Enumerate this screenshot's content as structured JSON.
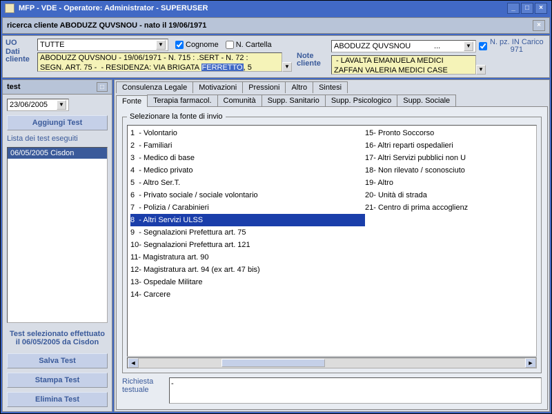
{
  "title": "MFP  - VDE  - Operatore: Administrator  - SUPERUSER",
  "client_bar": "ricerca cliente  ABODUZZ QUVSNOU - nato il 19/06/1971",
  "filters": {
    "uo_label": "UO",
    "uo_value": "TUTTE",
    "cognome": "Cognome",
    "ncartella": "N. Cartella",
    "client_name": "ABODUZZ QUVSNOU",
    "client_dots": "...",
    "dati_label": "Dati cliente",
    "dati_line1": "ABODUZZ QUVSNOU - 19/06/1971 - N. 715 : .SERT - N. 72 :",
    "dati_line2a": "SEGN. ART. 75 -  - RESIDENZA: VIA BRIGATA ",
    "dati_line2_hl": "FERRETTO",
    "dati_line2b": ", 5",
    "note_label": "Note cliente",
    "note_line1": " - LAVALTA EMANUELA MEDICI",
    "note_line2": "ZAFFAN VALERIA MEDICI CASE",
    "np_label": "N. pz. IN Carico",
    "np_value": "971"
  },
  "left": {
    "title": "test",
    "date": "23/06/2005",
    "add": "Aggiungi Test",
    "list_label": "Lista dei test eseguiti",
    "item": "06/05/2005   Cisdon",
    "status": "Test selezionato effettuato il 06/05/2005 da Cisdon",
    "save": "Salva Test",
    "print": "Stampa Test",
    "del": "Elimina Test"
  },
  "tabs_row1": [
    "Consulenza Legale",
    "Motivazioni",
    "Pressioni",
    "Altro",
    "Sintesi"
  ],
  "tabs_row2": [
    "Fonte",
    "Terapia farmacol.",
    "Comunità",
    "Supp. Sanitario",
    "Supp. Psicologico",
    "Supp. Sociale"
  ],
  "active_tab": "Fonte",
  "fieldset": "Selezionare la fonte di invio",
  "list_left": [
    "1  - Volontario",
    "2  - Familiari",
    "3  - Medico di base",
    "4  - Medico privato",
    "5  - Altro Ser.T.",
    "6  - Privato sociale / sociale volontario",
    "7  - Polizia / Carabinieri",
    "8  - Altri Servizi ULSS",
    "9  - Segnalazioni Prefettura art. 75",
    "10- Segnalazioni Prefettura art. 121",
    "11- Magistratura art. 90",
    "12- Magistratura art. 94 (ex art. 47 bis)",
    "13- Ospedale Militare",
    "14- Carcere"
  ],
  "list_right": [
    "15- Pronto Soccorso",
    "16- Altri reparti ospedalieri",
    "17- Altri Servizi pubblici non U",
    "18- Non rilevato / sconosciuto",
    "19- Altro",
    "20- Unità di strada",
    "21- Centro di prima accoglienz"
  ],
  "selected_index": 7,
  "req_label": "Richiesta testuale",
  "req_value": "-"
}
